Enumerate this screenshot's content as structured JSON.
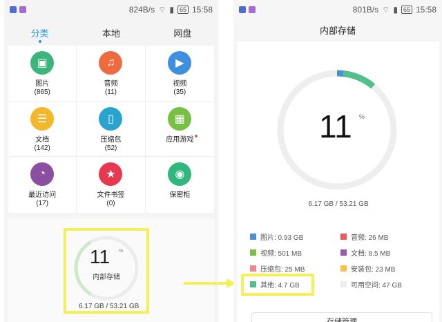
{
  "left": {
    "status": {
      "speed": "824B/s",
      "battery": "65",
      "time": "15:58"
    },
    "tabs": [
      {
        "label": "分类"
      },
      {
        "label": "本地"
      },
      {
        "label": "网盘"
      }
    ],
    "categories": [
      {
        "label": "图片",
        "count": "(865)",
        "icon": "image-icon",
        "color": "#3cb57a"
      },
      {
        "label": "音频",
        "count": "(11)",
        "icon": "music-icon",
        "color": "#ee6b40"
      },
      {
        "label": "视频",
        "count": "(35)",
        "icon": "video-icon",
        "color": "#3f8fe0"
      },
      {
        "label": "文档",
        "count": "(142)",
        "icon": "document-icon",
        "color": "#f3b72c"
      },
      {
        "label": "压缩包",
        "count": "(52)",
        "icon": "archive-icon",
        "color": "#29a4cf"
      },
      {
        "label": "应用游戏",
        "count": "",
        "icon": "apps-icon",
        "color": "#78c043"
      },
      {
        "label": "最近访问",
        "count": "(17)",
        "icon": "clock-icon",
        "color": "#8a4fa0"
      },
      {
        "label": "文件书签",
        "count": "(0)",
        "icon": "star-icon",
        "color": "#e8384f"
      },
      {
        "label": "保密柜",
        "count": "",
        "icon": "safe-icon",
        "color": "#2fb77e"
      }
    ],
    "storage": {
      "percent": "11",
      "pct_sign": "%",
      "label": "内部存储",
      "size": "6.17 GB / 53.21 GB",
      "used_fraction": 0.11
    }
  },
  "right": {
    "status": {
      "speed": "801B/s",
      "battery": "65",
      "time": "15:58"
    },
    "title": "内部存储",
    "storage": {
      "percent": "11",
      "pct_sign": "%",
      "size": "6.17 GB / 53.21 GB"
    },
    "legend": [
      {
        "label": "图片: 0.93 GB",
        "color": "#4a8fd8"
      },
      {
        "label": "音频: 26 MB",
        "color": "#e85a5a"
      },
      {
        "label": "视频: 501 MB",
        "color": "#79c045"
      },
      {
        "label": "文档: 8.5 MB",
        "color": "#9b59b6"
      },
      {
        "label": "压缩包: 25 MB",
        "color": "#f08a8a"
      },
      {
        "label": "安装包: 23 MB",
        "color": "#f5c14a"
      },
      {
        "label": "其他: 4.7 GB",
        "color": "#52c08a"
      },
      {
        "label": "可用空间: 47 GB",
        "color": "#eeeeee"
      }
    ],
    "ring": {
      "segments": [
        {
          "color": "#4a8fd8",
          "fraction": 0.018
        },
        {
          "color": "#52c08a",
          "fraction": 0.092
        }
      ]
    },
    "button_label": "存储管理"
  },
  "colors": {
    "accent": "#1e9bd7",
    "highlight": "#f5f05a"
  }
}
